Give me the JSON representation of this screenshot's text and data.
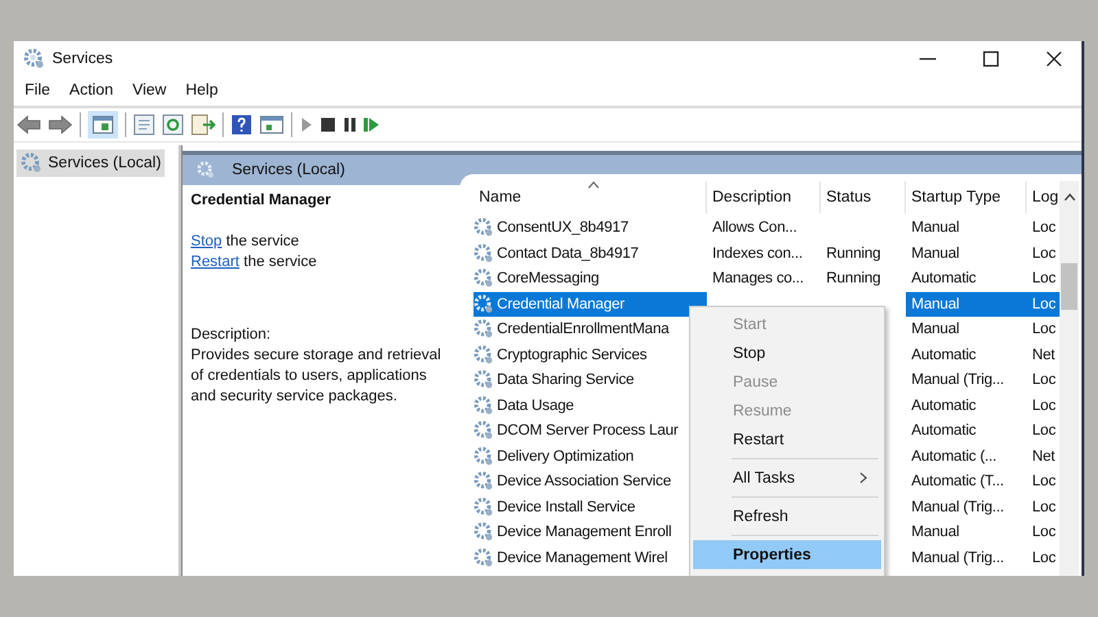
{
  "window": {
    "title": "Services"
  },
  "menu_bar": [
    "File",
    "Action",
    "View",
    "Help"
  ],
  "tree": {
    "items": [
      {
        "label": "Services (Local)",
        "selected": true
      }
    ]
  },
  "pane_header": "Services (Local)",
  "details": {
    "title": "Credential Manager",
    "actions": [
      {
        "link": "Stop",
        "text": "the service"
      },
      {
        "link": "Restart",
        "text": "the service"
      }
    ],
    "description_label": "Description:",
    "description": "Provides secure storage and retrieval of credentials to users, applications and security service packages."
  },
  "table": {
    "columns": [
      "Name",
      "Description",
      "Status",
      "Startup Type",
      "Log"
    ],
    "rows": [
      {
        "name": "ConsentUX_8b4917",
        "description": "Allows Con...",
        "status": "",
        "startup_type": "Manual",
        "log_on_as": "Loc",
        "selected": false
      },
      {
        "name": "Contact Data_8b4917",
        "description": "Indexes con...",
        "status": "Running",
        "startup_type": "Manual",
        "log_on_as": "Loc",
        "selected": false
      },
      {
        "name": "CoreMessaging",
        "description": "Manages co...",
        "status": "Running",
        "startup_type": "Automatic",
        "log_on_as": "Loc",
        "selected": false
      },
      {
        "name": "Credential Manager",
        "startup_type": "Manual",
        "log_on_as": "Loc",
        "selected": true
      },
      {
        "name": "CredentialEnrollmentMana",
        "startup_type": "Manual",
        "log_on_as": "Loc",
        "selected": false
      },
      {
        "name": "Cryptographic Services",
        "startup_type": "Automatic",
        "log_on_as": "Net",
        "selected": false
      },
      {
        "name": "Data Sharing Service",
        "startup_type": "Manual (Trig...",
        "log_on_as": "Loc",
        "selected": false
      },
      {
        "name": "Data Usage",
        "startup_type": "Automatic",
        "log_on_as": "Loc",
        "selected": false
      },
      {
        "name": "DCOM Server Process Laur",
        "startup_type": "Automatic",
        "log_on_as": "Loc",
        "selected": false
      },
      {
        "name": "Delivery Optimization",
        "startup_type": "Automatic (...",
        "log_on_as": "Net",
        "selected": false
      },
      {
        "name": "Device Association Service",
        "startup_type": "Automatic (T...",
        "log_on_as": "Loc",
        "selected": false
      },
      {
        "name": "Device Install Service",
        "startup_type": "Manual (Trig...",
        "log_on_as": "Loc",
        "selected": false
      },
      {
        "name": "Device Management Enroll",
        "startup_type": "Manual",
        "log_on_as": "Loc",
        "selected": false
      },
      {
        "name": "Device Management Wirel",
        "startup_type": "Manual (Trig...",
        "log_on_as": "Loc",
        "selected": false
      }
    ]
  },
  "context_menu": {
    "items": [
      {
        "kind": "item",
        "label": "Start",
        "disabled": true,
        "selected": false
      },
      {
        "kind": "item",
        "label": "Stop",
        "disabled": false,
        "selected": false
      },
      {
        "kind": "item",
        "label": "Pause",
        "disabled": true,
        "selected": false
      },
      {
        "kind": "item",
        "label": "Resume",
        "disabled": true,
        "selected": false
      },
      {
        "kind": "item",
        "label": "Restart",
        "disabled": false,
        "selected": false
      },
      {
        "kind": "separator"
      },
      {
        "kind": "submenu",
        "label": "All Tasks",
        "disabled": false,
        "selected": false
      },
      {
        "kind": "separator"
      },
      {
        "kind": "item",
        "label": "Refresh",
        "disabled": false,
        "selected": false
      },
      {
        "kind": "separator"
      },
      {
        "kind": "item",
        "label": "Properties",
        "disabled": false,
        "selected": true
      }
    ]
  }
}
